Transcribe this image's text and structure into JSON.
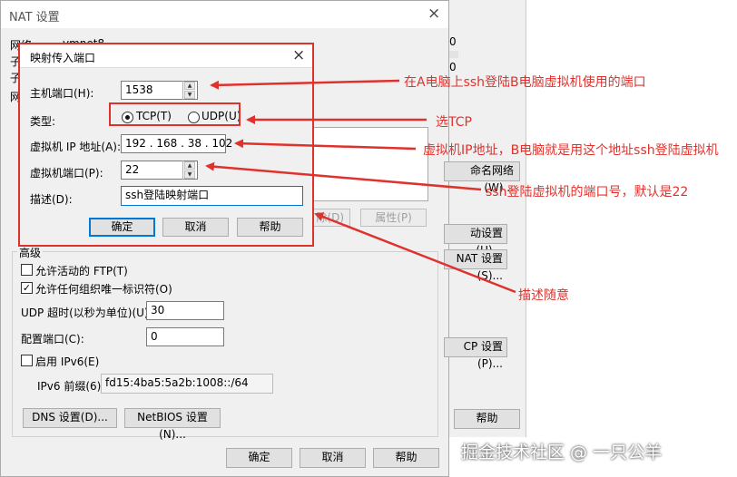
{
  "bg_window": {
    "title": "NAT 设置",
    "close": "×",
    "row_labels": [
      "网络:",
      "子",
      "子",
      "网"
    ],
    "network_value": "vmnet8",
    "side_values": [
      "0",
      "0"
    ],
    "rename_btn": "命名网络(W)...",
    "delete_btn": "除(D)",
    "props_btn": "属性(P)",
    "auto_btn": "动设置(U)...",
    "nat_btn": "NAT 设置(S)...",
    "dhcp_btn": "CP 设置(P)...",
    "help_btn": "帮助"
  },
  "advanced": {
    "title": "高级",
    "ftp": "允许活动的 FTP(T)",
    "oui": "允许任何组织唯一标识符(O)",
    "udp_label": "UDP 超时(以秒为单位)(U):",
    "udp_value": "30",
    "port_label": "配置端口(C):",
    "port_value": "0",
    "ipv6_enable": "启用 IPv6(E)",
    "ipv6_label": "IPv6 前缀(6):",
    "ipv6_value": "fd15:4ba5:5a2b:1008::/64",
    "dns_btn": "DNS 设置(D)...",
    "netbios_btn": "NetBIOS 设置(N)...",
    "ok": "确定",
    "cancel": "取消",
    "help": "帮助"
  },
  "dialog": {
    "title": "映射传入端口",
    "close": "×",
    "host_port_label": "主机端口(H):",
    "host_port_value": "1538",
    "type_label": "类型:",
    "tcp": "TCP(T)",
    "udp": "UDP(U)",
    "vm_ip_label": "虚拟机 IP 地址(A):",
    "vm_ip_value": "192 . 168 . 38 . 102",
    "vm_port_label": "虚拟机端口(P):",
    "vm_port_value": "22",
    "desc_label": "描述(D):",
    "desc_value": "ssh登陆映射端口",
    "ok": "确定",
    "cancel": "取消",
    "help": "帮助"
  },
  "annotations": {
    "host_port": "在A电脑上ssh登陆B电脑虚拟机使用的端口",
    "type": "选TCP",
    "vm_ip": "虚拟机IP地址，B电脑就是用这个地址ssh登陆虚拟机",
    "vm_port": "ssh登陆虚拟机的端口号，默认是22",
    "desc": "描述随意",
    "color": "#e0322d"
  },
  "watermark": "掘金技术社区 @ 一只公羊"
}
